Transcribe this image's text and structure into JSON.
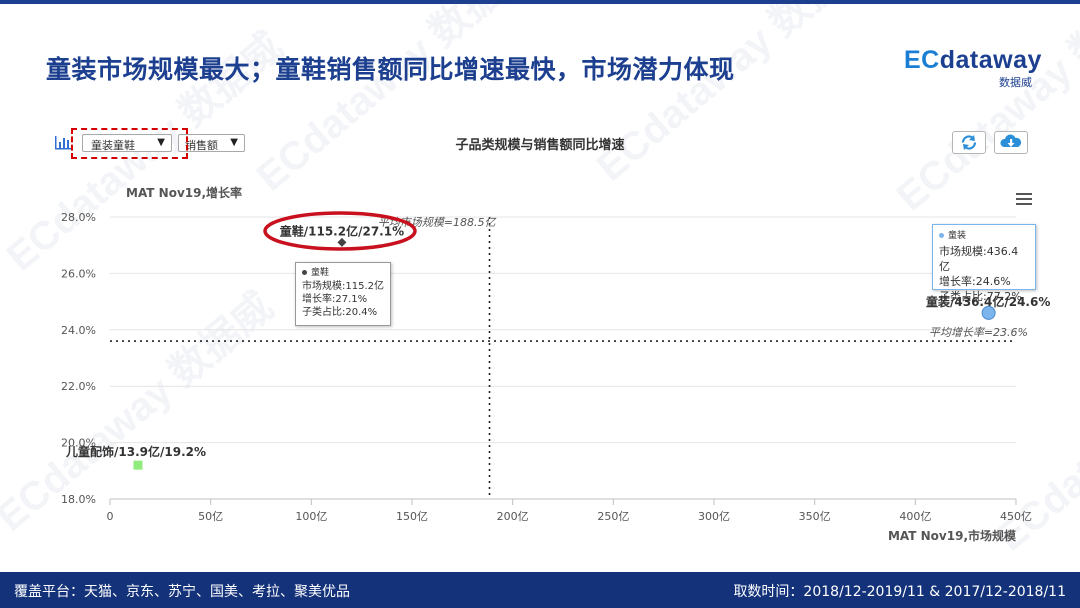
{
  "slide": {
    "title": "童装市场规模最大；童鞋销售额同比增速最快，市场潜力体现",
    "logo_ec": "EC",
    "logo_word": "dataway",
    "logo_sub": "数据威",
    "watermark": "ECdataway 数据威"
  },
  "toolbar": {
    "category_select": "童装童鞋",
    "metric_select": "销售额",
    "chart_icon": "bar-chart-icon",
    "refresh_icon": "refresh-icon",
    "download_icon": "cloud-download-icon",
    "menu_icon": "hamburger-menu-icon",
    "highlight_color": "#d40000"
  },
  "footer": {
    "platforms": "覆盖平台：天猫、京东、苏宁、国美、考拉、聚美优品",
    "period": "取数时间：2018/12-2019/11 & 2017/12-2018/11"
  },
  "tooltips": {
    "shoes": {
      "name": "童鞋",
      "line1": "市场规模:115.2亿",
      "line2": "增长率:27.1%",
      "line3": "子类占比:20.4%"
    },
    "clothing": {
      "name": "童装",
      "line1": "市场规模:436.4亿",
      "line2": "增长率:24.6%",
      "line3": "子类占比:77.2%"
    }
  },
  "chart_data": {
    "type": "scatter",
    "title": "子品类规模与销售额同比增速",
    "ylabel": "MAT Nov19,增长率",
    "xlabel": "MAT Nov19,市场规模",
    "xlim": [
      0,
      450
    ],
    "ylim": [
      18,
      28
    ],
    "xticks": [
      "0",
      "50亿",
      "100亿",
      "150亿",
      "200亿",
      "250亿",
      "300亿",
      "350亿",
      "400亿",
      "450亿"
    ],
    "yticks": [
      "18.0%",
      "20.0%",
      "22.0%",
      "24.0%",
      "26.0%",
      "28.0%"
    ],
    "points": [
      {
        "name": "童鞋",
        "x": 115.2,
        "y": 27.1,
        "label": "童鞋/115.2亿/27.1%",
        "marker": "diamond",
        "color": "#444444"
      },
      {
        "name": "童装",
        "x": 436.4,
        "y": 24.6,
        "label": "童装/436.4亿/24.6%",
        "marker": "circle",
        "color": "#7cb5ec"
      },
      {
        "name": "儿童配饰",
        "x": 13.9,
        "y": 19.2,
        "label": "儿童配饰/13.9亿/19.2%",
        "marker": "square",
        "color": "#90ed7d"
      }
    ],
    "reference_lines": {
      "avg_size": {
        "value": 188.5,
        "label": "平均市场规模=188.5亿"
      },
      "avg_growth": {
        "value": 23.6,
        "label": "平均增长率=23.6%"
      }
    },
    "grid": true
  }
}
